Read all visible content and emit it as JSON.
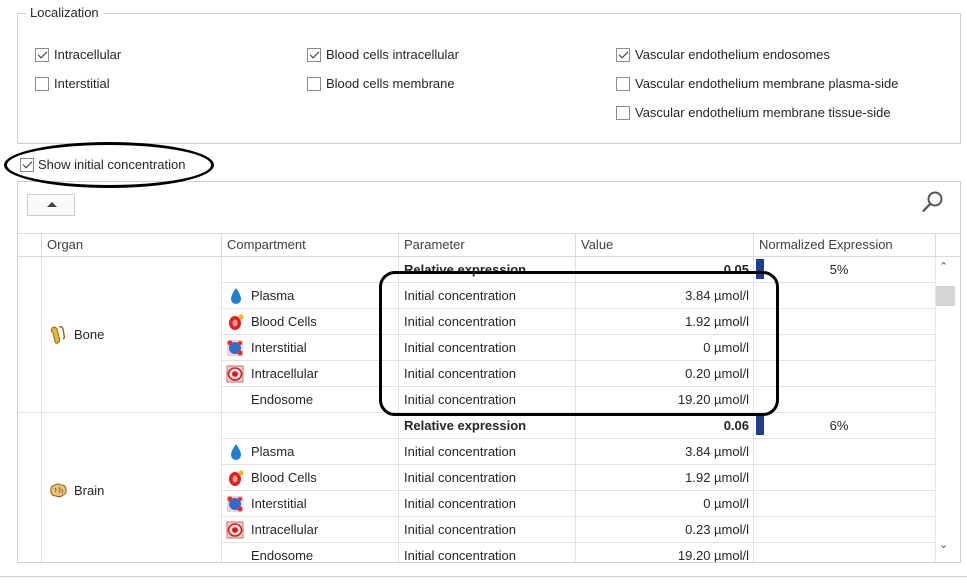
{
  "localization": {
    "title": "Localization",
    "options": [
      {
        "label": "Intracellular",
        "checked": true
      },
      {
        "label": "Interstitial",
        "checked": false
      },
      {
        "label": "Blood cells intracellular",
        "checked": true
      },
      {
        "label": "Blood cells membrane",
        "checked": false
      },
      {
        "label": "Vascular endothelium endosomes",
        "checked": true
      },
      {
        "label": "Vascular endothelium membrane plasma-side",
        "checked": false
      },
      {
        "label": "Vascular endothelium membrane tissue-side",
        "checked": false
      }
    ]
  },
  "show_initial": {
    "label": "Show initial concentration",
    "checked": true
  },
  "grid": {
    "columns": [
      "Organ",
      "Compartment",
      "Parameter",
      "Value",
      "Normalized Expression"
    ],
    "bar_color": "#1f3e8c",
    "organs": [
      {
        "name": "Bone",
        "icon": "bone-icon",
        "relative": {
          "parameter": "Relative expression",
          "value": "0.05",
          "percent_label": "5%",
          "fraction": 0.05
        },
        "rows": [
          {
            "compartment": "Plasma",
            "icon": "plasma-icon",
            "parameter": "Initial concentration",
            "value": "3.84 µmol/l"
          },
          {
            "compartment": "Blood Cells",
            "icon": "blood-cells-icon",
            "parameter": "Initial concentration",
            "value": "1.92 µmol/l"
          },
          {
            "compartment": "Interstitial",
            "icon": "interstitial-icon",
            "parameter": "Initial concentration",
            "value": "0 µmol/l"
          },
          {
            "compartment": "Intracellular",
            "icon": "intracellular-icon",
            "parameter": "Initial concentration",
            "value": "0.20 µmol/l"
          },
          {
            "compartment": "Endosome",
            "icon": "",
            "parameter": "Initial concentration",
            "value": "19.20 µmol/l"
          }
        ]
      },
      {
        "name": "Brain",
        "icon": "brain-icon",
        "relative": {
          "parameter": "Relative expression",
          "value": "0.06",
          "percent_label": "6%",
          "fraction": 0.06
        },
        "rows": [
          {
            "compartment": "Plasma",
            "icon": "plasma-icon",
            "parameter": "Initial concentration",
            "value": "3.84 µmol/l"
          },
          {
            "compartment": "Blood Cells",
            "icon": "blood-cells-icon",
            "parameter": "Initial concentration",
            "value": "1.92 µmol/l"
          },
          {
            "compartment": "Interstitial",
            "icon": "interstitial-icon",
            "parameter": "Initial concentration",
            "value": "0 µmol/l"
          },
          {
            "compartment": "Intracellular",
            "icon": "intracellular-icon",
            "parameter": "Initial concentration",
            "value": "0.23 µmol/l"
          },
          {
            "compartment": "Endosome",
            "icon": "",
            "parameter": "Initial concentration",
            "value": "19.20 µmol/l"
          }
        ]
      }
    ]
  }
}
